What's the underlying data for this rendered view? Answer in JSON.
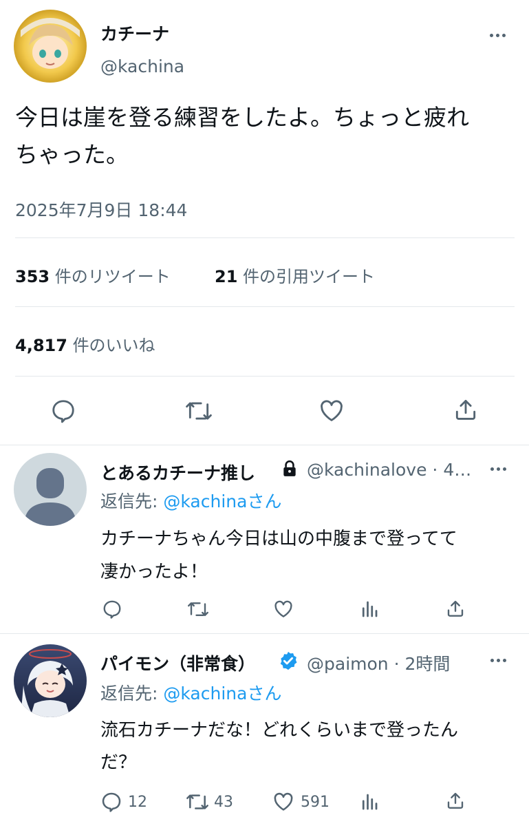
{
  "main_tweet": {
    "author": {
      "name": "カチーナ",
      "handle": "@kachina"
    },
    "text_line1": "今日は崖を登る練習をしたよ。ちょっと疲れ",
    "text_line2": "ちゃった。",
    "timestamp": "2025年7月9日 18:44",
    "retweets": {
      "count": "353",
      "label": "件のリツイート"
    },
    "quotes": {
      "count": "21",
      "label": "件の引用ツイート"
    },
    "likes": {
      "count": "4,817",
      "label": "件のいいね"
    }
  },
  "replies": [
    {
      "name": "とあるカチーナ推し",
      "handle_time": "@kachinalove · 4…",
      "reply_to_label": "返信先:",
      "reply_to_handle": "@kachinaさん",
      "text_line1": "カチーナちゃん今日は山の中腹まで登ってて",
      "text_line2": "凄かったよ！",
      "avatar": "default-profile-icon",
      "lock": "lock-icon"
    },
    {
      "name": "パイモン（非常食）",
      "handle_time": "@paimon · 2時間",
      "reply_to_label": "返信先:",
      "reply_to_handle": "@kachinaさん",
      "text_line1": "流石カチーナだな！どれくらいまで登ったん",
      "text_line2": "だ？",
      "replies_count": "12",
      "retweets_count": "43",
      "likes_count": "591",
      "verified": "verified-badge-icon"
    }
  ],
  "colors": {
    "accent": "#1d9bf0",
    "text": "#0f1419",
    "muted": "#536471",
    "divider": "#e4e8eb"
  }
}
